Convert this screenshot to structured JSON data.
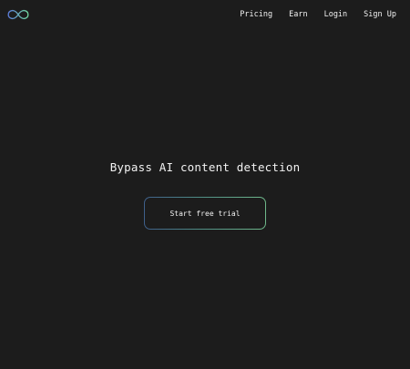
{
  "logo": {
    "icon": "infinity-icon",
    "color_start": "#5b7bd6",
    "color_end": "#6fd19a"
  },
  "nav": {
    "items": [
      {
        "label": "Pricing"
      },
      {
        "label": "Earn"
      },
      {
        "label": "Login"
      },
      {
        "label": "Sign Up"
      }
    ]
  },
  "hero": {
    "headline": "Bypass AI content detection",
    "cta_label": "Start free trial"
  },
  "colors": {
    "background": "#1c1c1c",
    "text": "#f2f2f2",
    "cta_border_start": "#3f5f8a",
    "cta_border_end": "#6fb88a"
  }
}
